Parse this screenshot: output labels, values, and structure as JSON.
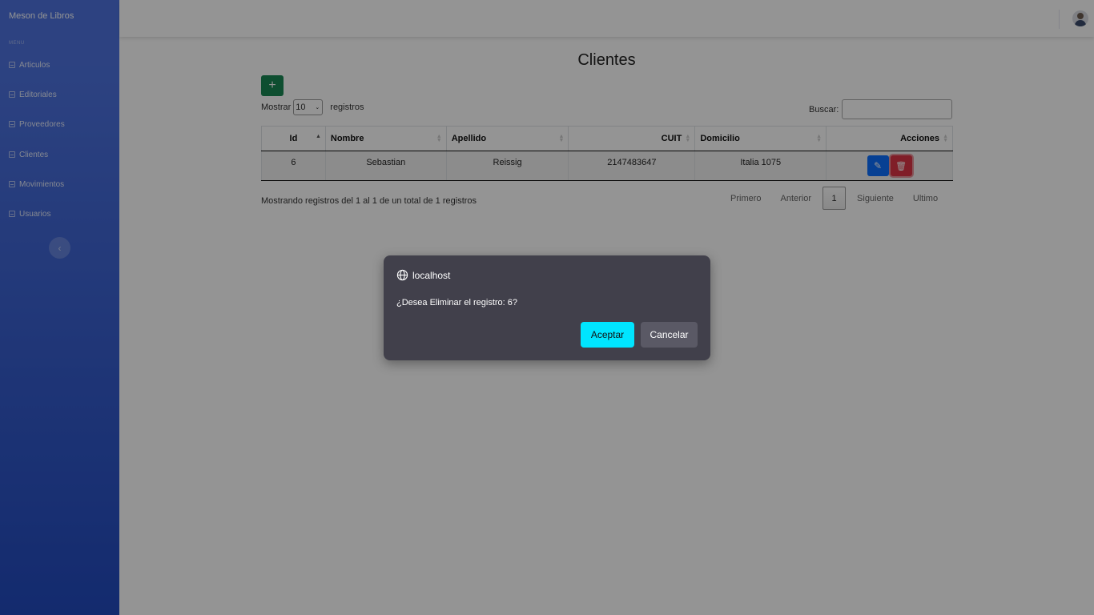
{
  "sidebar": {
    "brand": "Meson de Libros",
    "section_label": "MENU",
    "items": [
      {
        "label": "Articulos",
        "icon": "table-icon"
      },
      {
        "label": "Editoriales",
        "icon": "table-icon"
      },
      {
        "label": "Proveedores",
        "icon": "table-icon"
      },
      {
        "label": "Clientes",
        "icon": "table-icon"
      },
      {
        "label": "Movimientos",
        "icon": "table-icon"
      },
      {
        "label": "Usuarios",
        "icon": "table-icon"
      }
    ],
    "toggle_icon": "chevron-left-icon"
  },
  "topbar": {
    "avatar_icon": "user-avatar"
  },
  "main": {
    "title": "Clientes",
    "add_button_label": "+",
    "show_prefix": "Mostrar",
    "page_size": "10",
    "show_suffix": "registros",
    "search_label": "Buscar:",
    "search_value": "",
    "table": {
      "columns": [
        "Id",
        "Nombre",
        "Apellido",
        "CUIT",
        "Domicilio",
        "Acciones"
      ],
      "rows": [
        {
          "id": "6",
          "nombre": "Sebastian",
          "apellido": "Reissig",
          "cuit": "2147483647",
          "domicilio": "Italia 1075"
        }
      ]
    },
    "info": "Mostrando registros del 1 al 1 de un total de 1 registros",
    "pager": {
      "first": "Primero",
      "prev": "Anterior",
      "current": "1",
      "next": "Siguiente",
      "last": "Ultimo"
    }
  },
  "dialog": {
    "origin": "localhost",
    "message": "¿Desea Eliminar el registro: 6?",
    "ok_label": "Aceptar",
    "cancel_label": "Cancelar"
  },
  "colors": {
    "sidebar": "#4e73df",
    "add_button": "#198754",
    "edit_button": "#0d6efd",
    "delete_button": "#dc3545",
    "dialog_bg": "#41404b",
    "accept_button": "#00e5ff"
  }
}
